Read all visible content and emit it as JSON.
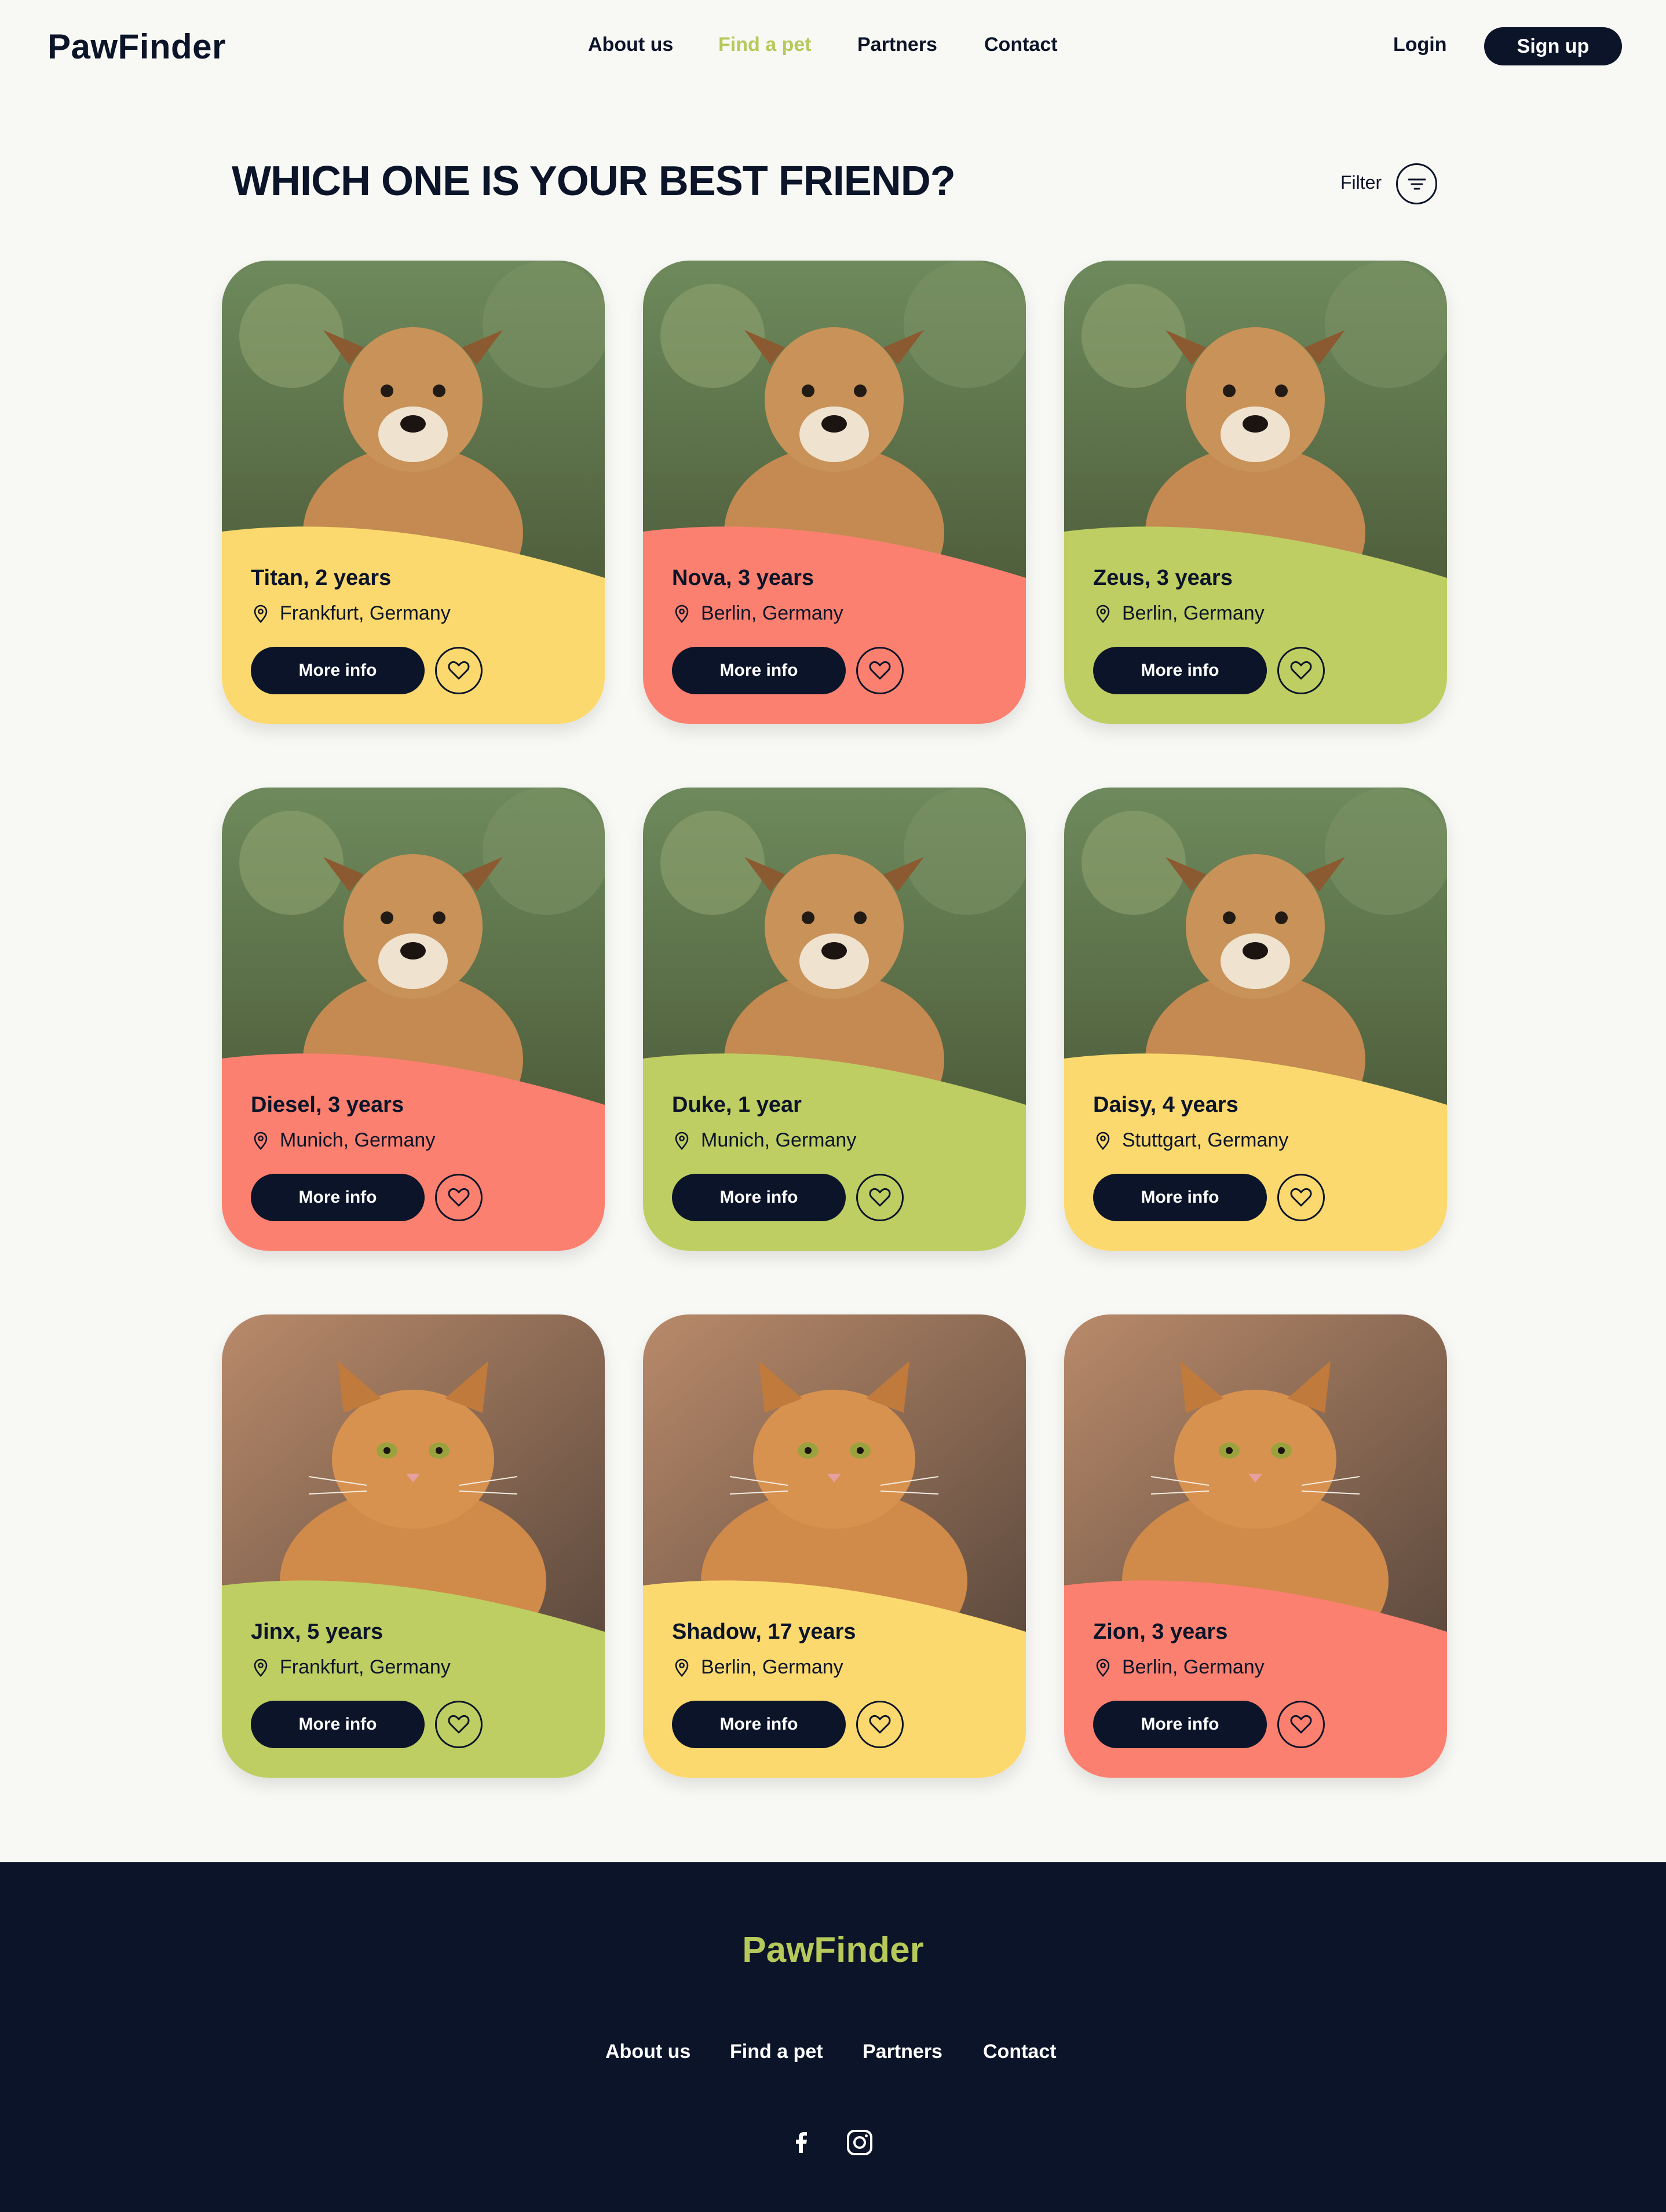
{
  "header": {
    "logo": "PawFinder",
    "nav": [
      {
        "label": "About us",
        "active": false
      },
      {
        "label": "Find a pet",
        "active": true
      },
      {
        "label": "Partners",
        "active": false
      },
      {
        "label": "Contact",
        "active": false
      }
    ],
    "login_label": "Login",
    "signup_label": "Sign up"
  },
  "main": {
    "title": "Which one is your best friend?",
    "filter_label": "Filter",
    "more_info_label": "More info",
    "pets": [
      {
        "name": "Titan, 2 years",
        "location": "Frankfurt, Germany",
        "color": "#fcd96e",
        "image": "dog"
      },
      {
        "name": "Nova, 3 years",
        "location": "Berlin, Germany",
        "color": "#fc8070",
        "image": "dog"
      },
      {
        "name": "Zeus, 3 years",
        "location": "Berlin, Germany",
        "color": "#bfce62",
        "image": "dog"
      },
      {
        "name": "Diesel, 3 years",
        "location": "Munich, Germany",
        "color": "#fc8070",
        "image": "dog"
      },
      {
        "name": "Duke, 1 year",
        "location": "Munich, Germany",
        "color": "#bfce62",
        "image": "dog"
      },
      {
        "name": "Daisy, 4 years",
        "location": "Stuttgart, Germany",
        "color": "#fcd96e",
        "image": "dog"
      },
      {
        "name": "Jinx, 5 years",
        "location": "Frankfurt, Germany",
        "color": "#bfce62",
        "image": "cat"
      },
      {
        "name": "Shadow, 17 years",
        "location": "Berlin, Germany",
        "color": "#fcd96e",
        "image": "cat"
      },
      {
        "name": "Zion, 3 years",
        "location": "Berlin, Germany",
        "color": "#fc8070",
        "image": "cat"
      }
    ]
  },
  "footer": {
    "logo": "PawFinder",
    "nav": [
      "About us",
      "Find a pet",
      "Partners",
      "Contact"
    ],
    "social": [
      "facebook-icon",
      "instagram-icon"
    ]
  },
  "colors": {
    "navy": "#0b1428",
    "accent_green": "#b6c95a",
    "card_yellow": "#fcd96e",
    "card_coral": "#fc8070",
    "card_green": "#bfce62"
  }
}
